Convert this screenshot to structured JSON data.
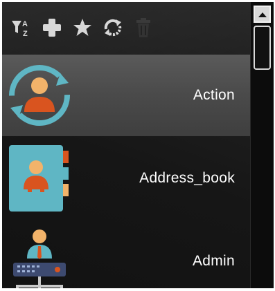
{
  "toolbar": {
    "buttons": [
      {
        "name": "sort-az-icon",
        "enabled": true
      },
      {
        "name": "add-icon",
        "enabled": true
      },
      {
        "name": "star-icon",
        "enabled": true
      },
      {
        "name": "refresh-icon",
        "enabled": true
      },
      {
        "name": "trash-icon",
        "enabled": false
      }
    ],
    "sort_letters": {
      "top": "A",
      "bottom": "Z"
    }
  },
  "list": {
    "items": [
      {
        "label": "Action",
        "icon": "user-sync-icon",
        "selected": true
      },
      {
        "label": "Address_book",
        "icon": "address-book-icon",
        "selected": false
      },
      {
        "label": "Admin",
        "icon": "admin-network-icon",
        "selected": false
      }
    ]
  },
  "colors": {
    "background": "#1c1c1c",
    "selected_row": "#4e4e4e",
    "icon_teal": "#5fb6c4",
    "icon_orange": "#d9541f",
    "icon_skin": "#f2b36a",
    "label": "#ffffff",
    "toolbar_icon": "#d8d8d8",
    "toolbar_icon_disabled": "#3a3a3a"
  }
}
